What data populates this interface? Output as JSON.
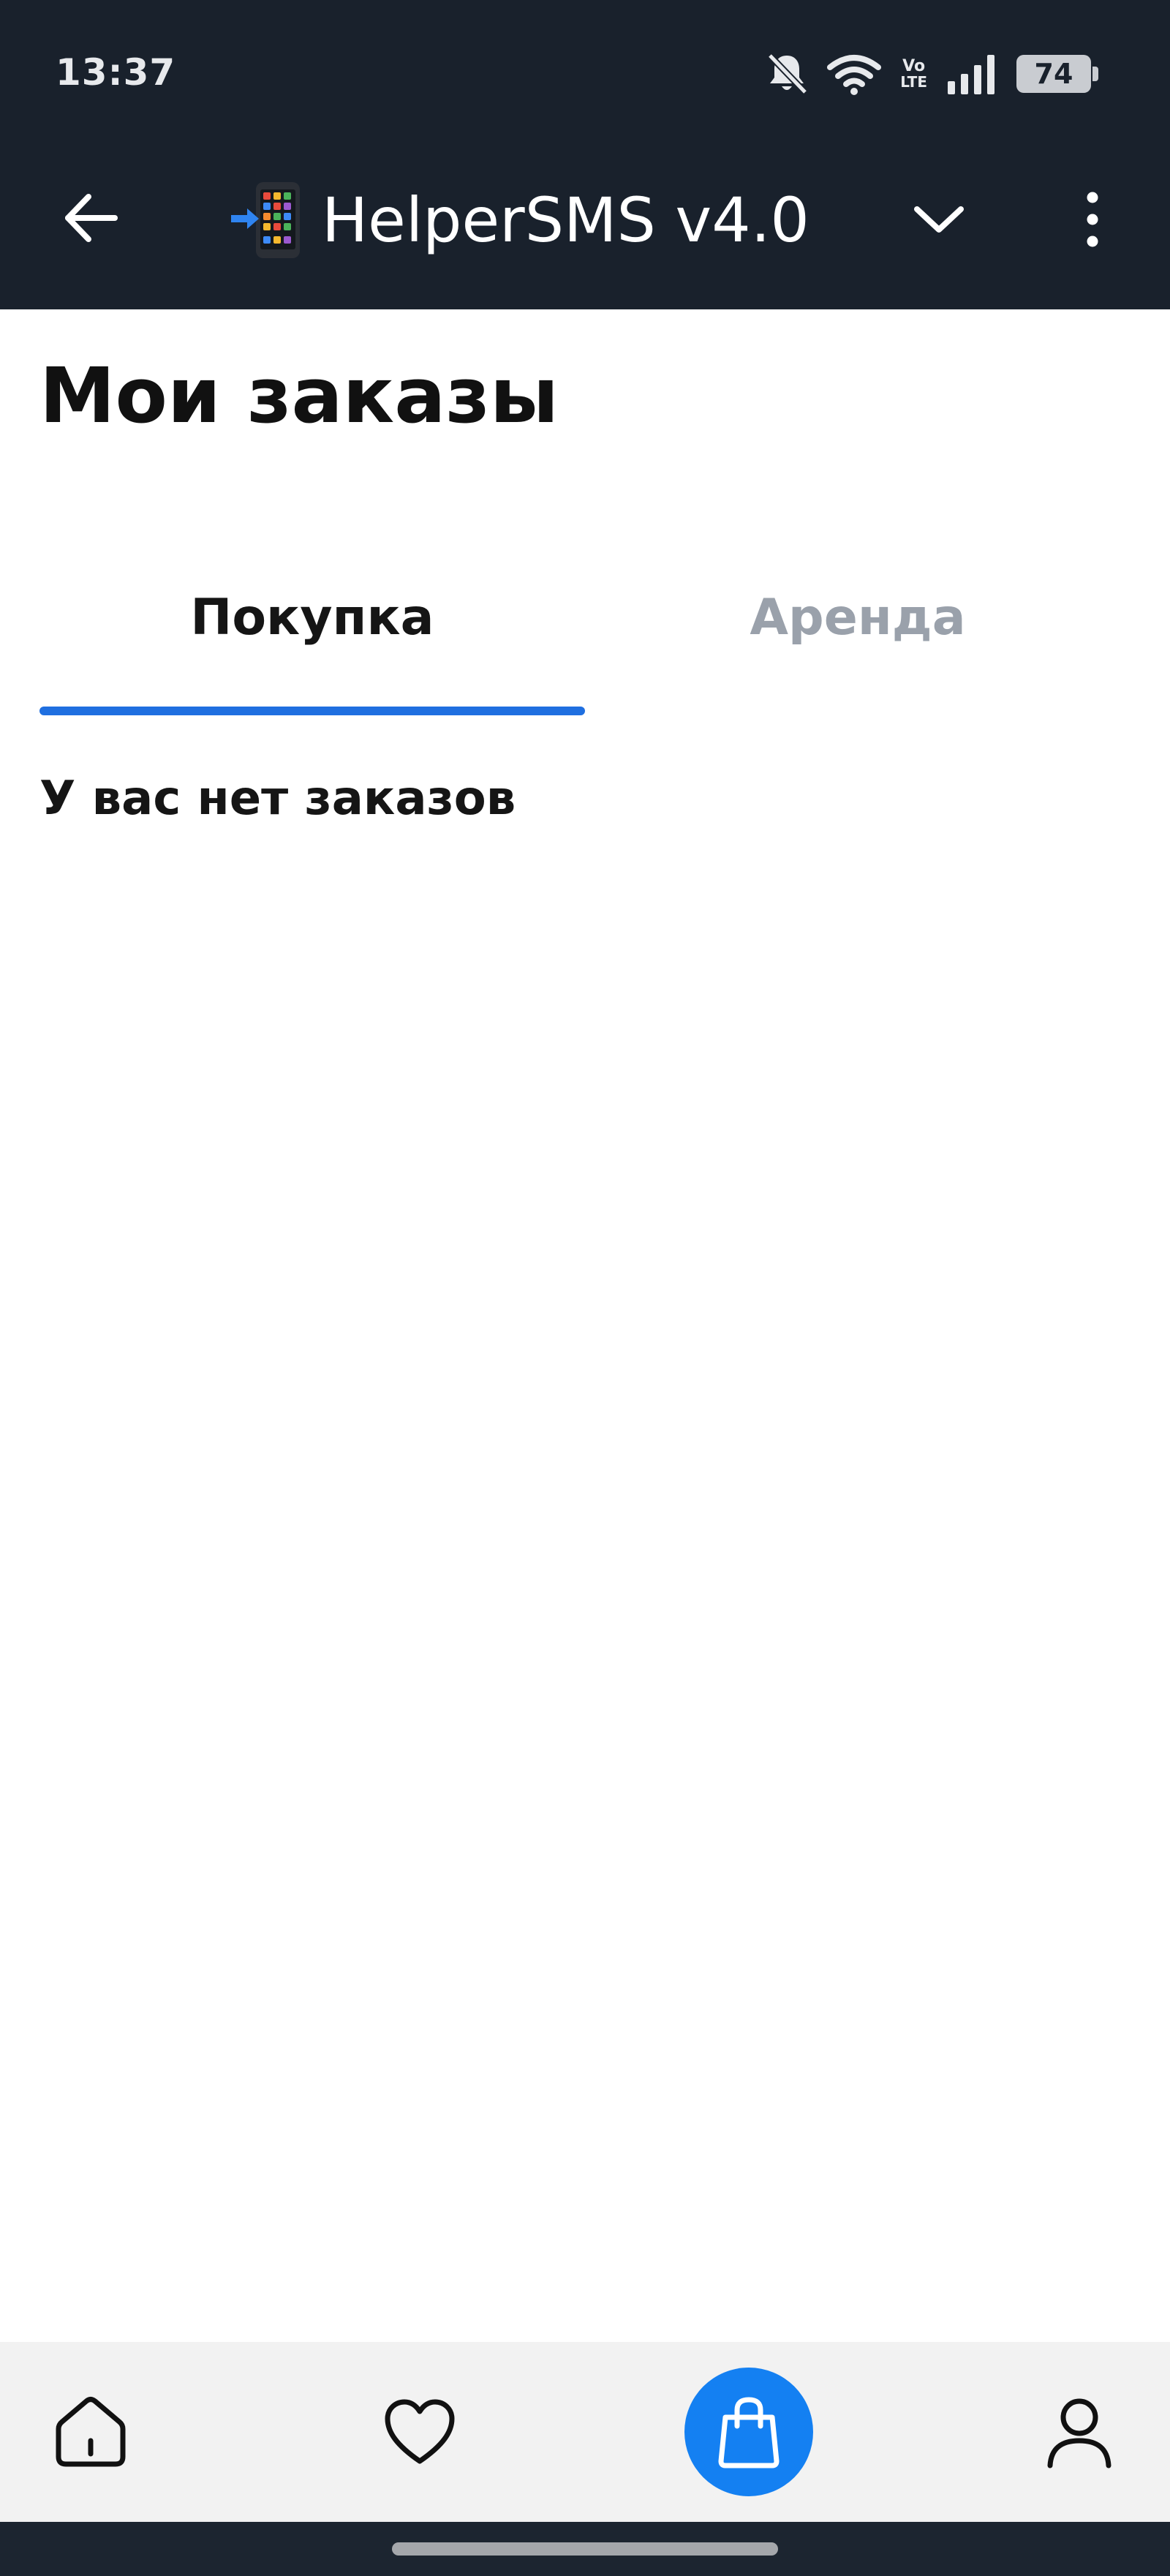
{
  "status_bar": {
    "time": "13:37",
    "battery_level": "74",
    "icons": [
      "bell-off-icon",
      "wifi-icon",
      "volte-icon",
      "signal-icon",
      "battery-icon"
    ],
    "volte_top": "Vo",
    "volte_bottom": "LTE"
  },
  "app_bar": {
    "title": "HelperSMS v4.0",
    "logo_icon": "phone-with-arrow-icon",
    "back_icon": "arrow-left-icon",
    "expand_icon": "chevron-down-icon",
    "menu_icon": "more-vertical-icon",
    "background": "#19212c"
  },
  "page": {
    "title": "Мои заказы",
    "tabs": [
      {
        "label": "Покупка",
        "active": true
      },
      {
        "label": "Аренда",
        "active": false
      }
    ],
    "empty_message": "У вас нет заказов",
    "accent_color": "#1f6fe0"
  },
  "bottom_nav": {
    "items": [
      {
        "icon": "home-icon",
        "active": false
      },
      {
        "icon": "heart-icon",
        "active": false
      },
      {
        "icon": "shopping-bag-icon",
        "active": true
      },
      {
        "icon": "user-icon",
        "active": false
      }
    ],
    "active_color": "#1480f2"
  }
}
